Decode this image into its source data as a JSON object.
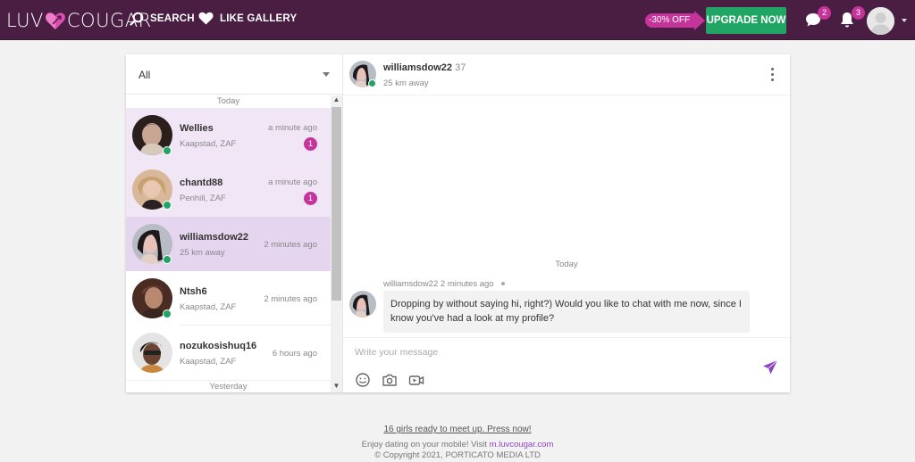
{
  "header": {
    "logo_left": "LUV",
    "logo_right": "COUGAR",
    "nav": [
      {
        "label": "SEARCH",
        "icon": "search-icon"
      },
      {
        "label": "LIKE GALLERY",
        "icon": "heart-icon"
      }
    ],
    "discount_label": "-30% OFF",
    "upgrade_label": "UPGRADE NOW",
    "messages_count": "2",
    "notifications_count": "3"
  },
  "colors": {
    "topbar": "#4a1d42",
    "accent_pink": "#c4349a",
    "upgrade_green": "#21a565",
    "online_green": "#21a565",
    "send_purple": "#8e44c4",
    "unread_bg": "#f0e6f6",
    "active_bg": "#e5d5ef"
  },
  "sidebar": {
    "filter_value": "All",
    "today_label": "Today",
    "yesterday_label": "Yesterday",
    "conversations": [
      {
        "name": "Wellies",
        "location": "Kaapstad, ZAF",
        "time": "a minute ago",
        "unread": "1",
        "online": true,
        "state": "unread"
      },
      {
        "name": "chantd88",
        "location": "Penhill, ZAF",
        "time": "a minute ago",
        "unread": "1",
        "online": true,
        "state": "unread"
      },
      {
        "name": "williamsdow22",
        "location": "25 km away",
        "time": "2 minutes ago",
        "unread": null,
        "online": true,
        "state": "active"
      },
      {
        "name": "Ntsh6",
        "location": "Kaapstad, ZAF",
        "time": "2 minutes ago",
        "unread": null,
        "online": true,
        "state": "read"
      },
      {
        "name": "nozukosishuq16",
        "location": "Kaapstad, ZAF",
        "time": "6 hours ago",
        "unread": null,
        "online": false,
        "state": "read"
      }
    ]
  },
  "chat": {
    "name": "williamsdow22",
    "age": "37",
    "distance": "25 km away",
    "day_label": "Today",
    "messages": [
      {
        "sender": "williamsdow22",
        "time": "2 minutes ago",
        "text": "Dropping by without saying hi, right?) Would you like to chat with me now, since I know you've had a look at my profile?"
      }
    ],
    "composer_placeholder": "Write your message"
  },
  "footer": {
    "promo": "16 girls ready to meet up. Press now!",
    "mobile_text": "Enjoy dating on your mobile! Visit ",
    "mobile_link": "m.luvcougar.com",
    "copyright": "© Copyright 2021, PORTICATO MEDIA LTD"
  }
}
